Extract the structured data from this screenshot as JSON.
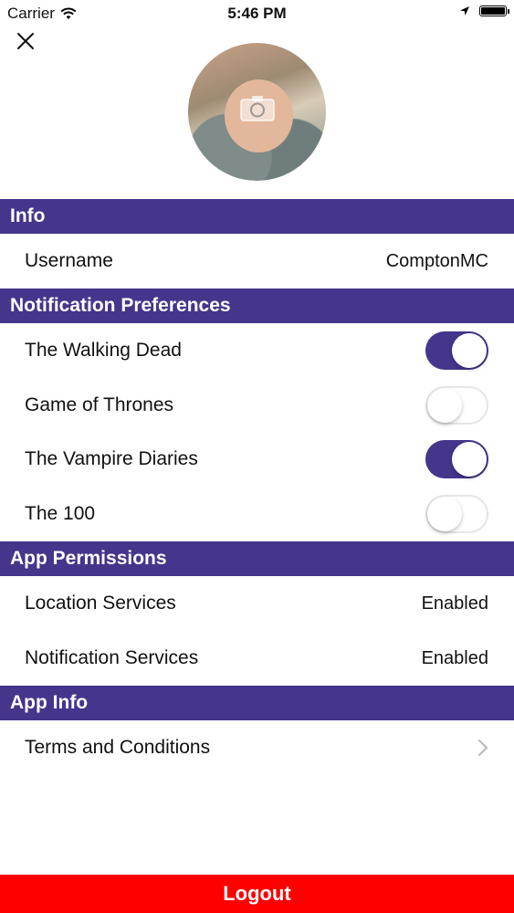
{
  "status_bar": {
    "carrier": "Carrier",
    "time": "5:46 PM",
    "icons": [
      "wifi-icon",
      "location-arrow-icon",
      "battery-icon"
    ]
  },
  "header": {
    "close_icon": "close-icon",
    "avatar_overlay_icon": "camera-icon"
  },
  "sections": {
    "info": {
      "title": "Info",
      "username_label": "Username",
      "username_value": "ComptonMC"
    },
    "notifications": {
      "title": "Notification Preferences",
      "items": [
        {
          "label": "The Walking Dead",
          "enabled": true
        },
        {
          "label": "Game of Thrones",
          "enabled": false
        },
        {
          "label": "The Vampire Diaries",
          "enabled": true
        },
        {
          "label": "The 100",
          "enabled": false
        }
      ]
    },
    "permissions": {
      "title": "App Permissions",
      "items": [
        {
          "label": "Location Services",
          "value": "Enabled"
        },
        {
          "label": "Notification Services",
          "value": "Enabled"
        }
      ]
    },
    "app_info": {
      "title": "App Info",
      "terms_label": "Terms and Conditions"
    }
  },
  "logout_label": "Logout",
  "colors": {
    "accent": "#45358b",
    "logout": "#ff0000",
    "toggle_off_border": "#e6e6e6"
  }
}
